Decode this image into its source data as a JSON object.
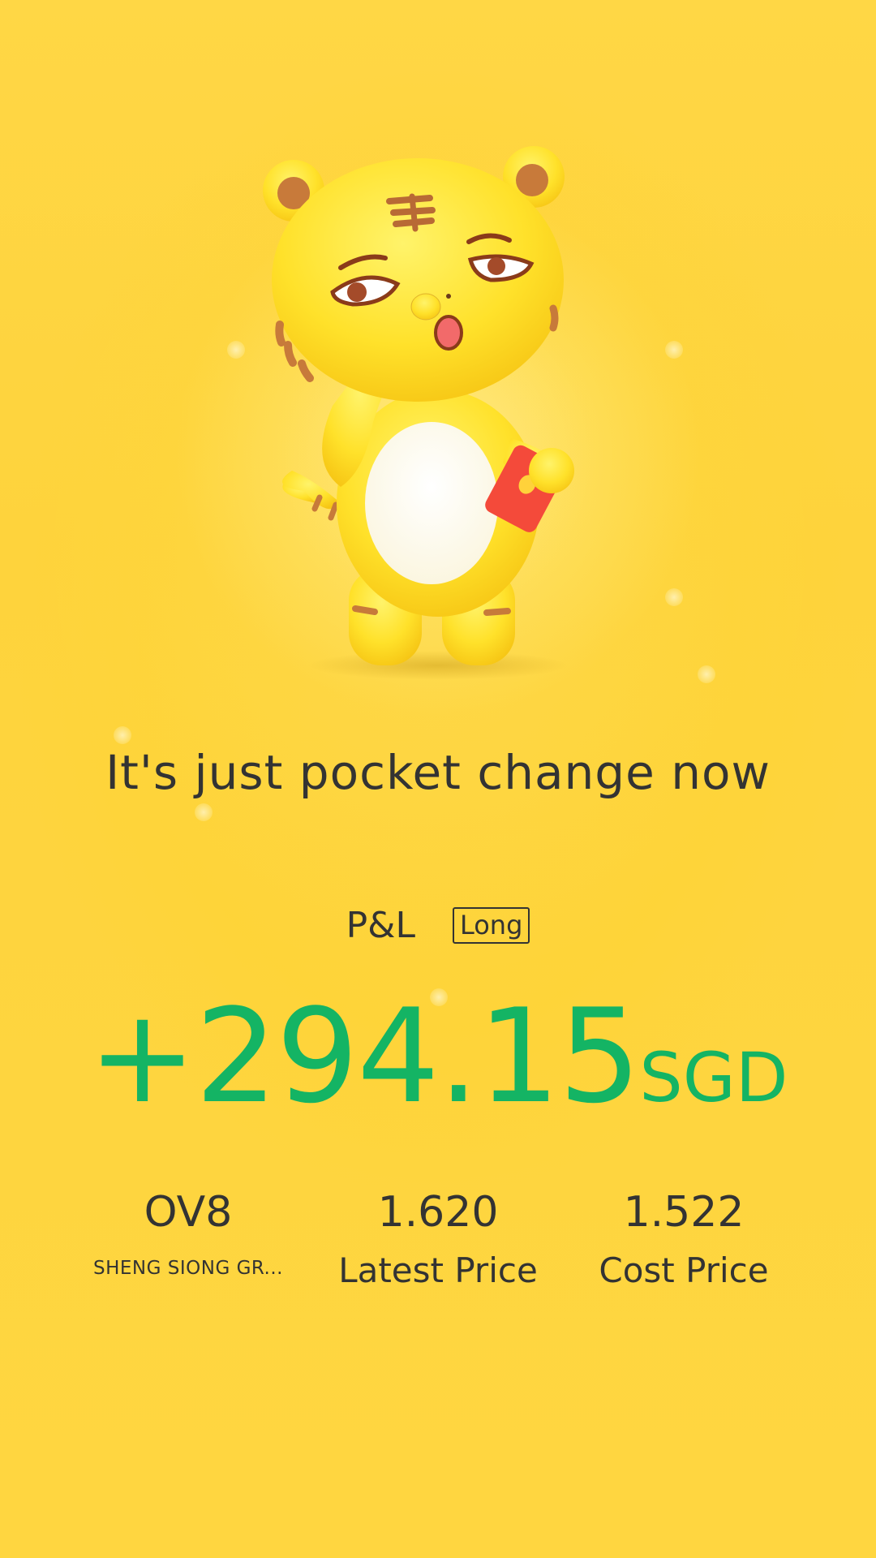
{
  "mascot": {
    "icon": "tiger-mascot-icon"
  },
  "headline": "It's just pocket change now",
  "pl": {
    "label": "P&L",
    "badge": "Long"
  },
  "pnl": {
    "value": "+294.15",
    "currency": "SGD",
    "color": "#14b464"
  },
  "stats": {
    "symbol": "OV8",
    "name": "SHENG SIONG GR...",
    "latest_price": "1.620",
    "latest_price_label": "Latest Price",
    "cost_price": "1.522",
    "cost_price_label": "Cost Price"
  },
  "colors": {
    "background": "#fed23a",
    "text": "#333333"
  }
}
